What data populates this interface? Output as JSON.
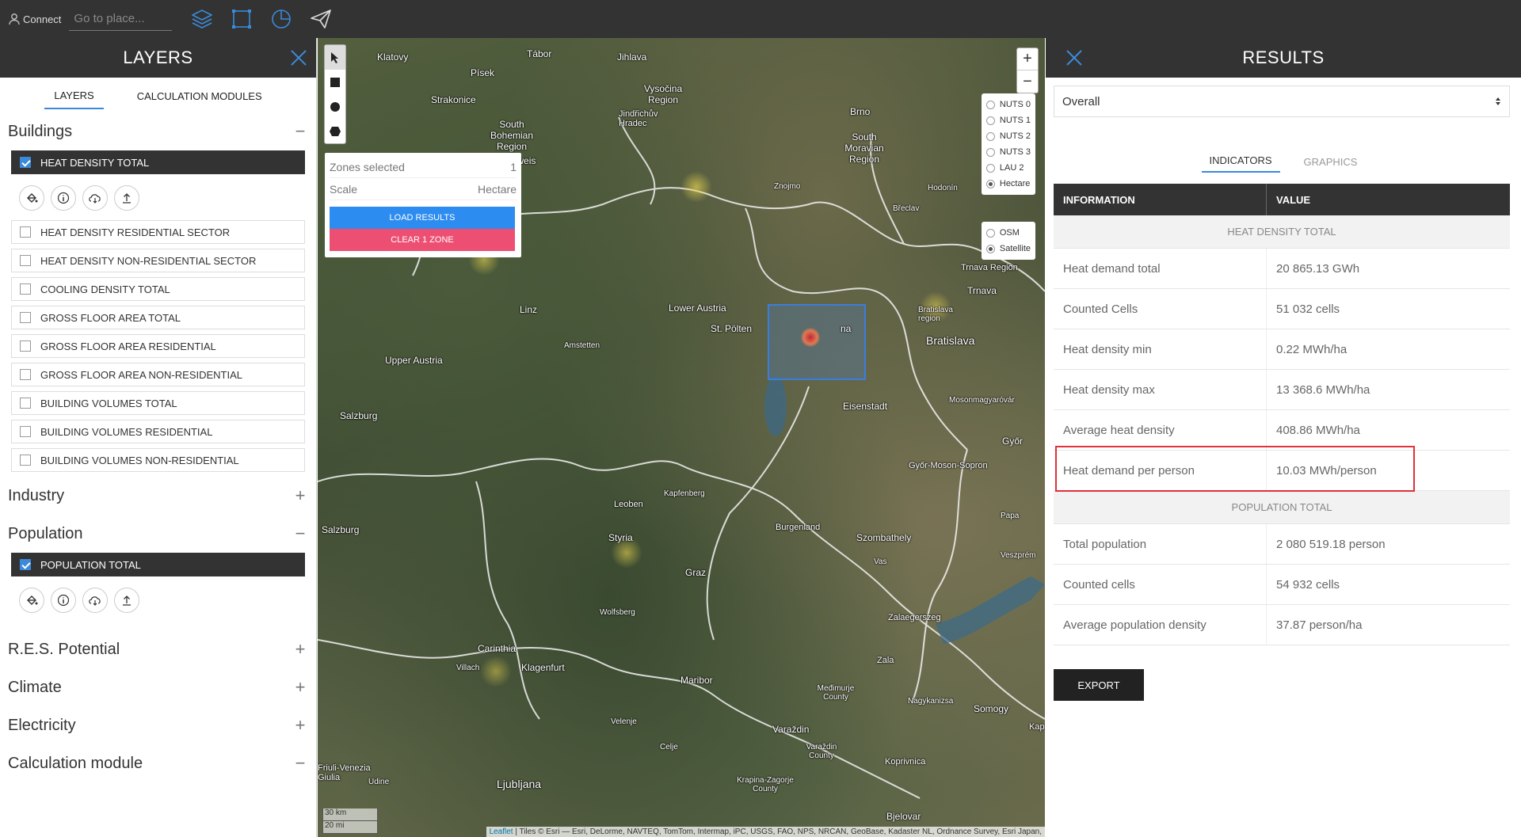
{
  "topbar": {
    "connect_label": "Connect",
    "search_placeholder": "Go to place..."
  },
  "left_panel": {
    "title": "LAYERS",
    "tabs": [
      "LAYERS",
      "CALCULATION MODULES"
    ],
    "sections": {
      "buildings": "Buildings",
      "industry": "Industry",
      "population": "Population",
      "res": "R.E.S. Potential",
      "climate": "Climate",
      "electricity": "Electricity",
      "calc": "Calculation module"
    },
    "building_layers": [
      "HEAT DENSITY TOTAL",
      "HEAT DENSITY RESIDENTIAL SECTOR",
      "HEAT DENSITY NON-RESIDENTIAL SECTOR",
      "COOLING DENSITY TOTAL",
      "GROSS FLOOR AREA TOTAL",
      "GROSS FLOOR AREA RESIDENTIAL",
      "GROSS FLOOR AREA NON-RESIDENTIAL",
      "BUILDING VOLUMES TOTAL",
      "BUILDING VOLUMES RESIDENTIAL",
      "BUILDING VOLUMES NON-RESIDENTIAL"
    ],
    "population_layers": [
      "POPULATION TOTAL"
    ]
  },
  "map": {
    "zones_selected_label": "Zones selected",
    "zones_selected_value": "1",
    "scale_label": "Scale",
    "scale_value": "Hectare",
    "load_results": "LOAD RESULTS",
    "clear_zone": "CLEAR 1 ZONE",
    "nuts_options": [
      "NUTS 0",
      "NUTS 1",
      "NUTS 2",
      "NUTS 3",
      "LAU 2",
      "Hectare"
    ],
    "base_options": [
      "OSM",
      "Satellite"
    ],
    "scale_km": "30 km",
    "scale_mi": "20 mi",
    "attribution_link": "Leaflet",
    "attribution": "| Tiles © Esri — Esri, DeLorme, NAVTEQ, TomTom, Intermap, iPC, USGS, FAO, NPS, NRCAN, GeoBase, Kadaster NL, Ordnance Survey, Esri Japan,",
    "places": [
      "Klatovy",
      "Tábor",
      "Jihlava",
      "Písek",
      "Vysočina Region",
      "Strakonice",
      "Jindřichův Hradec",
      "South Bohemian Region",
      "Budweis",
      "Brno",
      "South Moravian Region",
      "Znojmo",
      "Hodonín",
      "Břeclav",
      "Trnava Region",
      "Trnava",
      "Lower Austria",
      "St. Pölten",
      "Linz",
      "Amstetten",
      "Upper Austria",
      "Bratislava region",
      "Bratislava",
      "Eisenstadt",
      "Mosonmagyaróvár",
      "Salzburg",
      "Győr",
      "Győr-Moson-Sopron",
      "Leoben",
      "Kapfenberg",
      "Burgenland",
      "Papa",
      "Salzburg",
      "Styria",
      "Szombathely",
      "Graz",
      "Vas",
      "Veszprém",
      "Wolfsberg",
      "Zalaegerszeg",
      "Carinthia",
      "Klagenfurt",
      "Zala",
      "Villach",
      "Maribor",
      "Nagykanizsa",
      "Somogy",
      "Velenje",
      "Varaždin",
      "Međimurje County",
      "Celje",
      "Varaždin County",
      "Koprivnica",
      "Kap",
      "Friuli-Venezia Giulia",
      "Udine",
      "Ljubljana",
      "Krapina-Zagorje County",
      "Bjelovar",
      "na"
    ]
  },
  "right_panel": {
    "title": "RESULTS",
    "select_value": "Overall",
    "tabs": [
      "INDICATORS",
      "GRAPHICS"
    ],
    "table_headers": [
      "INFORMATION",
      "VALUE"
    ],
    "groups": [
      {
        "title": "HEAT DENSITY TOTAL",
        "rows": [
          {
            "k": "Heat demand total",
            "v": "20 865.13 GWh"
          },
          {
            "k": "Counted Cells",
            "v": "51 032 cells"
          },
          {
            "k": "Heat density min",
            "v": "0.22 MWh/ha"
          },
          {
            "k": "Heat density max",
            "v": "13 368.6 MWh/ha"
          },
          {
            "k": "Average heat density",
            "v": "408.86 MWh/ha"
          },
          {
            "k": "Heat demand per person",
            "v": "10.03 MWh/person"
          }
        ]
      },
      {
        "title": "POPULATION TOTAL",
        "rows": [
          {
            "k": "Total population",
            "v": "2 080 519.18 person"
          },
          {
            "k": "Counted cells",
            "v": "54 932 cells"
          },
          {
            "k": "Average population density",
            "v": "37.87 person/ha"
          }
        ]
      }
    ],
    "export_label": "EXPORT"
  },
  "colors": {
    "accent": "#2d8cf0",
    "clear": "#ed4f73",
    "highlight": "#e0303a",
    "dark": "#333333"
  }
}
